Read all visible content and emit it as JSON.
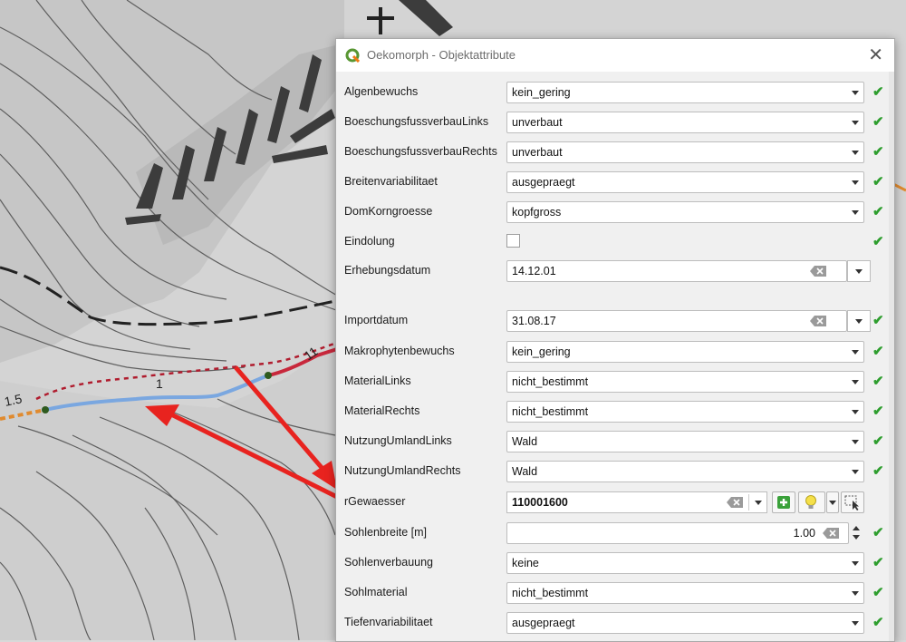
{
  "dialog": {
    "title": "Oekomorph - Objektattribute",
    "close_glyph": "✕"
  },
  "map": {
    "labels": {
      "km_1_5": "1.5",
      "km_1": "1",
      "km_11": "11"
    }
  },
  "check_glyph": "✔",
  "fields": {
    "algenbewuchs": {
      "label": "Algenbewuchs",
      "value": "kein_gering"
    },
    "boeschungsfussverbaulinks": {
      "label": "BoeschungsfussverbauLinks",
      "value": "unverbaut"
    },
    "boeschungsfussverbaurechts": {
      "label": "BoeschungsfussverbauRechts",
      "value": "unverbaut"
    },
    "breitenvariabilitaet": {
      "label": "Breitenvariabilitaet",
      "value": "ausgepraegt"
    },
    "domkorngroesse": {
      "label": "DomKorngroesse",
      "value": "kopfgross"
    },
    "eindolung": {
      "label": "Eindolung",
      "checked": false
    },
    "erhebungsdatum": {
      "label": "Erhebungsdatum",
      "value": "14.12.01"
    },
    "importdatum": {
      "label": "Importdatum",
      "value": "31.08.17"
    },
    "makrophytenbewuchs": {
      "label": "Makrophytenbewuchs",
      "value": "kein_gering"
    },
    "materiallinks": {
      "label": "MaterialLinks",
      "value": "nicht_bestimmt"
    },
    "materialrechts": {
      "label": "MaterialRechts",
      "value": "nicht_bestimmt"
    },
    "nutzungumlandlinks": {
      "label": "NutzungUmlandLinks",
      "value": "Wald"
    },
    "nutzungumlandrechts": {
      "label": "NutzungUmlandRechts",
      "value": "Wald"
    },
    "rgewaesser": {
      "label": "rGewaesser",
      "value": "110001600"
    },
    "sohlenbreite": {
      "label": "Sohlenbreite [m]",
      "value": "1.00"
    },
    "sohlenverbauung": {
      "label": "Sohlenverbauung",
      "value": "keine"
    },
    "sohlmaterial": {
      "label": "Sohlmaterial",
      "value": "nicht_bestimmt"
    },
    "tiefenvariabilitaet": {
      "label": "Tiefenvariabilitaet",
      "value": "ausgepraegt"
    }
  },
  "colors": {
    "accent_check": "#2e9e2e",
    "annotation_arrow": "#e8231f",
    "stream_blue": "#7aa7e0",
    "stream_red": "#c8283c"
  }
}
